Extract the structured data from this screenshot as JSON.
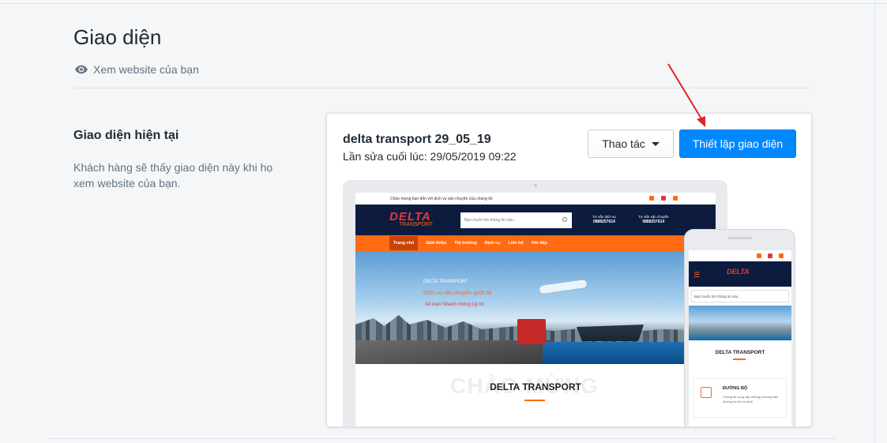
{
  "header": {
    "title": "Giao diện",
    "view_link": "Xem website của bạn"
  },
  "current_theme": {
    "section_title": "Giao diện hiện tại",
    "section_desc": "Khách hàng sẽ thấy giao diện này khi họ xem website của bạn.",
    "theme_name": "delta transport 29_05_19",
    "last_edited": "Lần sửa cuối lúc: 29/05/2019 09:22",
    "actions_label": "Thao tác",
    "setup_label": "Thiết lập giao diện",
    "accent_color": "#0088ff",
    "annotation_arrow_color": "#e02424"
  },
  "preview": {
    "topbar_text": "Chào mừng bạn đến với dịch vụ vận chuyển của chúng tôi",
    "logo_main": "DELTA",
    "logo_sub": "TRANSPORT",
    "search_placeholder": "Bạn muốn tìm thông tin nào...",
    "hotline1_label": "Tư vấn dịch vụ",
    "hotline1_number": "0888257614",
    "hotline2_label": "Tư vấn vận chuyển",
    "hotline2_number": "0888257614",
    "nav": [
      "Trang chủ",
      "Giới thiệu",
      "Thị trường",
      "Dịch vụ",
      "Liên hệ",
      "Hỏi đáp"
    ],
    "hero_line1": "DELTA TRANSPORT",
    "hero_line2": "Dịch vụ vận chuyển quốc tế",
    "hero_line3": "An toàn   Nhanh chóng   Uy tín",
    "welcome_bg": "CHÀO MỪNG",
    "welcome_title": "DELTA TRANSPORT",
    "mobile_section_title": "DELTA TRANSPORT",
    "mobile_card_title": "ĐƯỜNG BỘ",
    "mobile_card_desc": "Chúng tôi cung cấp những phương tiện đường bộ tối ưu nhất"
  }
}
